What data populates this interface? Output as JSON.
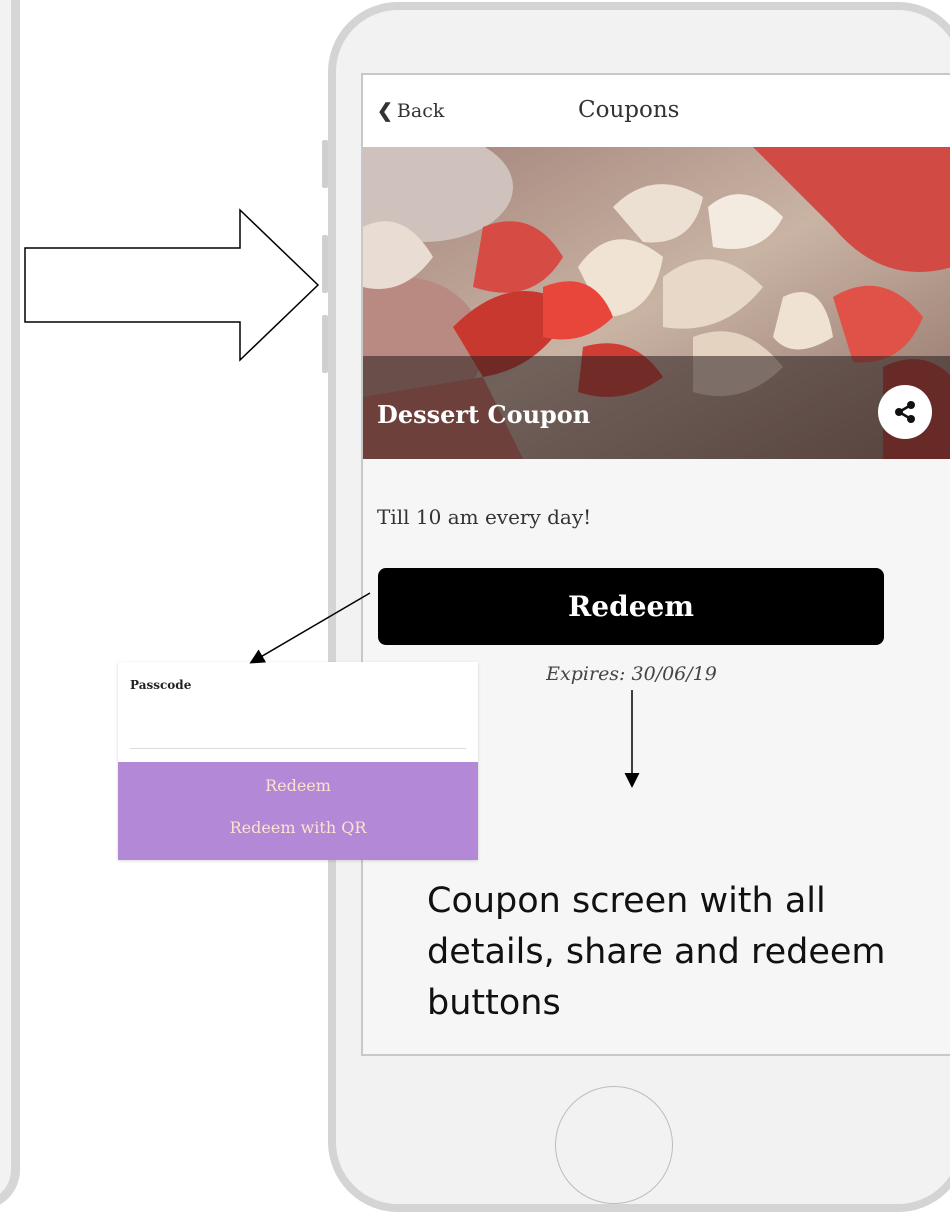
{
  "navbar": {
    "back_label": "Back",
    "title": "Coupons"
  },
  "coupon": {
    "title": "Dessert Coupon",
    "description": "Till 10 am every day!",
    "redeem_label": "Redeem",
    "expires_text": "Expires: 30/06/19"
  },
  "passcode_panel": {
    "label": "Passcode",
    "redeem_label": "Redeem",
    "redeem_qr_label": "Redeem with QR"
  },
  "caption": "Coupon screen with all details, share and redeem buttons",
  "icons": {
    "back": "chevron-left-icon",
    "share": "share-icon",
    "home": "home-button"
  },
  "colors": {
    "panel_accent": "#b388d6",
    "panel_text": "#fbe3cf",
    "redeem_bg": "#000000"
  }
}
